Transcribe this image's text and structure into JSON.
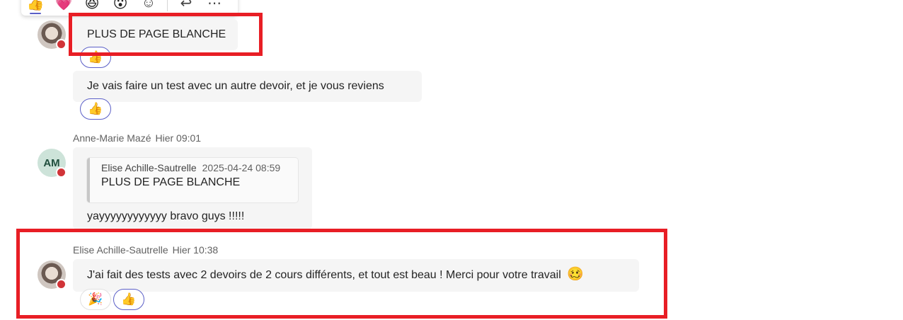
{
  "toolbar": {
    "reactions": [
      {
        "icon": "thumbs-up",
        "glyph": "👍",
        "selected": true
      },
      {
        "icon": "heart",
        "glyph": "💗"
      },
      {
        "icon": "laughing",
        "glyph": "😆"
      },
      {
        "icon": "surprised",
        "glyph": "😮"
      },
      {
        "icon": "add-reaction",
        "glyph": "☺"
      }
    ],
    "reply_icon": "↩",
    "more_icon": "⋯"
  },
  "messages": {
    "m1": {
      "text": "PLUS DE PAGE BLANCHE",
      "reaction": "👍"
    },
    "m2": {
      "text": "Je vais faire un test avec un autre devoir, et je vous reviens",
      "reaction": "👍"
    },
    "m3": {
      "author": "Anne-Marie Mazé",
      "time": "Hier 09:01",
      "initials": "AM",
      "quote": {
        "author": "Elise Achille-Sautrelle",
        "time": "2025-04-24 08:59",
        "text": "PLUS DE PAGE BLANCHE"
      },
      "text": "yayyyyyyyyyyyy bravo guys !!!!!"
    },
    "m4": {
      "author": "Elise Achille-Sautrelle",
      "time": "Hier 10:38",
      "text": "J'ai fait des tests avec 2 devoirs de 2 cours différents, et tout est beau ! Merci pour votre travail",
      "emoji": "🥴",
      "reactions": [
        "🎉",
        "👍"
      ]
    }
  },
  "colors": {
    "accent": "#5b5fc7",
    "highlight": "#e81e25",
    "status_busy": "#d13438",
    "bubble": "#f5f5f5"
  }
}
